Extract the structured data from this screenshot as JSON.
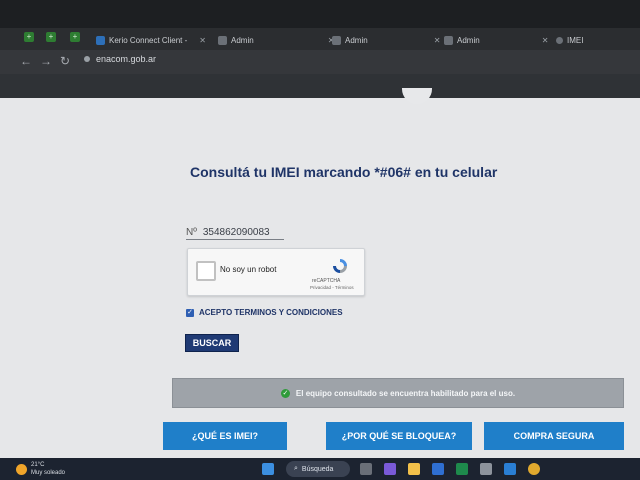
{
  "browser": {
    "tabs": [
      {
        "label": "Kerio Connect Client -"
      },
      {
        "label": "Admin"
      },
      {
        "label": "Admin"
      },
      {
        "label": "Admin"
      },
      {
        "label": "IMEI"
      }
    ],
    "url": "enacom.gob.ar"
  },
  "page": {
    "title": "Consultá tu IMEI marcando *#06# en tu celular",
    "imei_prefix": "Nº",
    "imei_value": "354862090083",
    "captcha": {
      "label": "No soy un robot",
      "brand": "reCAPTCHA",
      "terms": "Privacidad - Términos"
    },
    "terms_label": "ACEPTO TERMINOS Y CONDICIONES",
    "terms_checked": true,
    "search_button": "BUSCAR",
    "status_message": "El equipo consultado se encuentra habilitado para el uso.",
    "buttons": {
      "what_is_imei": "¿QUÉ ES IMEI?",
      "why_blocked": "¿POR QUÉ SE BLOQUEA?",
      "safe_purchase": "COMPRA SEGURA"
    }
  },
  "taskbar": {
    "weather_temp": "21°C",
    "weather_desc": "Muy soleado",
    "search_label": "Búsqueda"
  },
  "colors": {
    "title": "#1f3467",
    "primary_button": "#1f3a74",
    "big_buttons": "#1f7fc9",
    "status_bar": "#9ea3a9",
    "status_ok": "#2e9b3a"
  },
  "icons": [
    "back-arrow-icon",
    "forward-arrow-icon",
    "reload-icon",
    "check-circle-icon",
    "recaptcha-logo-icon",
    "windows-icon",
    "search-icon"
  ]
}
